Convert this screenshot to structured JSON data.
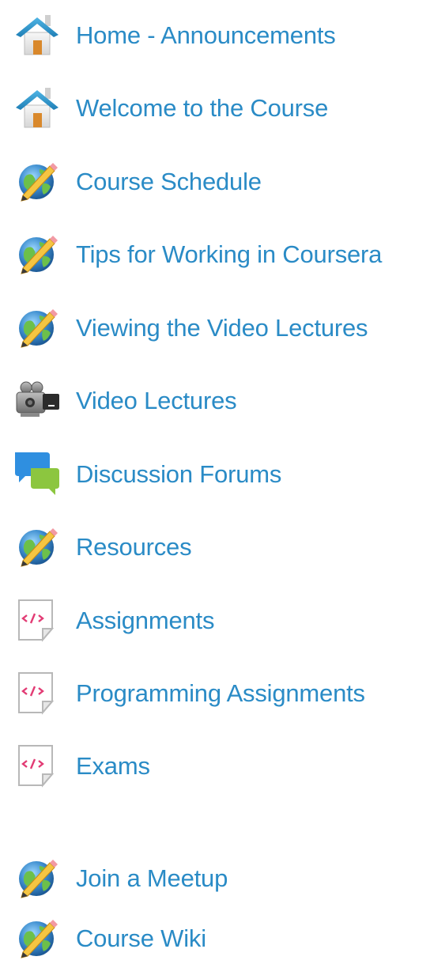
{
  "nav": {
    "items": [
      {
        "label": "Home - Announcements",
        "icon": "home-icon"
      },
      {
        "label": "Welcome to the Course",
        "icon": "home-icon"
      },
      {
        "label": "Course Schedule",
        "icon": "web-link-icon"
      },
      {
        "label": "Tips for Working in Coursera",
        "icon": "web-link-icon"
      },
      {
        "label": "Viewing the Video Lectures",
        "icon": "web-link-icon"
      },
      {
        "label": "Video Lectures",
        "icon": "video-camera-icon"
      },
      {
        "label": "Discussion Forums",
        "icon": "discussion-icon"
      },
      {
        "label": "Resources",
        "icon": "web-link-icon"
      },
      {
        "label": "Assignments",
        "icon": "code-page-icon"
      },
      {
        "label": "Programming Assignments",
        "icon": "code-page-icon"
      },
      {
        "label": "Exams",
        "icon": "code-page-icon"
      },
      {
        "label": "Join a Meetup",
        "icon": "web-link-icon"
      },
      {
        "label": "Course Wiki",
        "icon": "web-link-icon"
      }
    ]
  },
  "colors": {
    "link": "#2a8bc6",
    "background": "#ffffff"
  }
}
